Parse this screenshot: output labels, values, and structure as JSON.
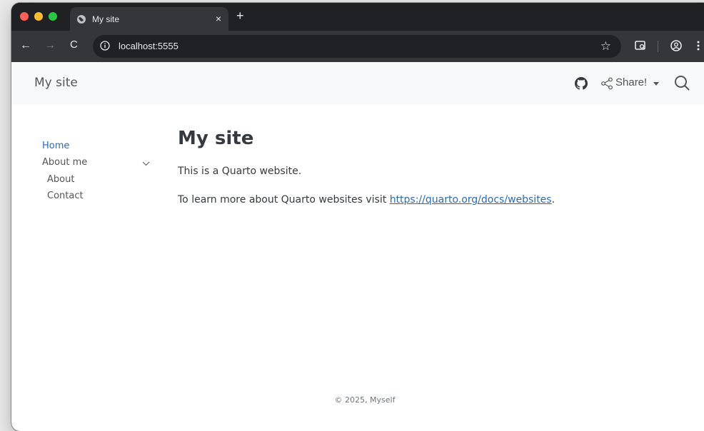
{
  "browser": {
    "tab_title": "My site",
    "tab_close": "×",
    "new_tab": "+",
    "url": "localhost:5555",
    "back": "←",
    "forward": "→",
    "reload": "C",
    "bookmark_star": "☆",
    "icons": [
      "globe-icon",
      "info-icon",
      "star-icon",
      "tab-search-icon",
      "account-icon",
      "more-icon"
    ]
  },
  "site": {
    "brand": "My site",
    "share_label": "Share!",
    "icons": [
      "github-icon",
      "share-icon",
      "search-icon"
    ]
  },
  "sidebar": {
    "home": "Home",
    "about_me": "About me",
    "about": "About",
    "contact": "Contact"
  },
  "content": {
    "title": "My site",
    "p1": "This is a Quarto website.",
    "p2_prefix": "To learn more about Quarto websites visit ",
    "p2_link": "https://quarto.org/docs/websites",
    "p2_suffix": "."
  },
  "footer": {
    "text": "© 2025, Myself"
  },
  "colors": {
    "link": "#2c69bd",
    "navbar_bg": "#f8f9fa",
    "browser_dark": "#202124",
    "browser_toolbar": "#35363a"
  }
}
